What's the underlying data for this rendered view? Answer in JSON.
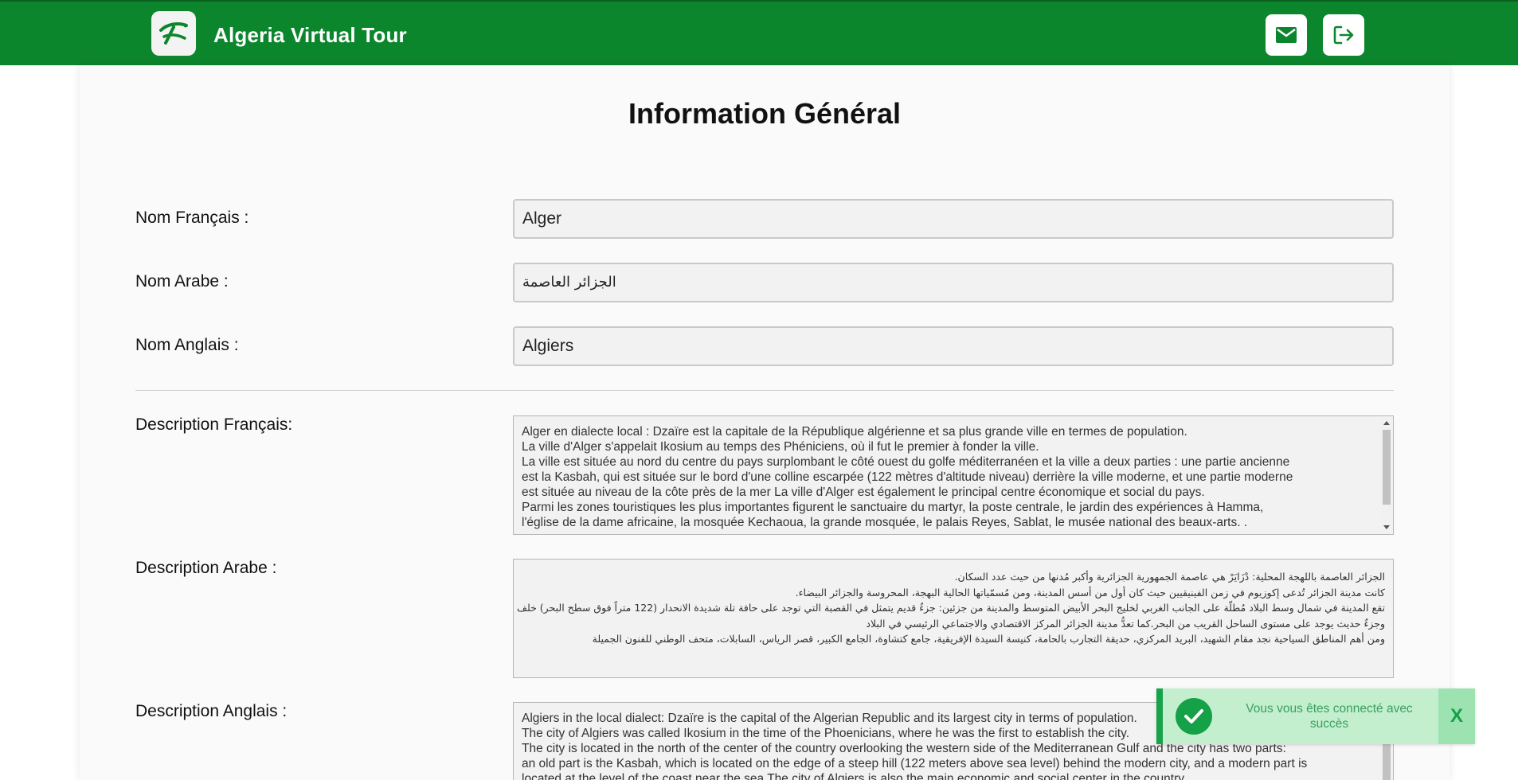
{
  "header": {
    "app_title": "Algeria Virtual Tour",
    "logo_icon": "logo-icon",
    "mail_icon": "mail-icon",
    "logout_icon": "logout-icon",
    "brand_color": "#0c862c"
  },
  "main": {
    "title": "Information Général",
    "fields": {
      "nom_fr": {
        "label": "Nom Français :",
        "value": "Alger"
      },
      "nom_ar": {
        "label": "Nom Arabe :",
        "value": "الجزائر العاصمة"
      },
      "nom_en": {
        "label": "Nom Anglais :",
        "value": "Algiers"
      }
    },
    "descriptions": {
      "fr": {
        "label": "Description Français:",
        "lines": [
          "Alger en dialecte local : Dzaïre est la capitale de la République algérienne et sa plus grande ville en termes de population.",
          "La ville d'Alger s'appelait Ikosium au temps des Phéniciens, où il fut le premier à fonder la ville.",
          "La ville est située au nord du centre du pays surplombant le côté ouest du golfe méditerranéen et la ville a deux parties : une partie ancienne",
          "est la Kasbah, qui est située sur le bord d'une colline escarpée (122 mètres d'altitude niveau) derrière la ville moderne, et une partie moderne",
          "est située au niveau de la côte près de la mer La ville d'Alger est également le principal centre économique et social du pays.",
          "Parmi les zones touristiques les plus importantes figurent le sanctuaire du martyr, la poste centrale, le jardin des expériences à Hamma,",
          "l'église de la dame africaine, la mosquée Kechaoua, la grande mosquée, le palais Reyes, Sablat, le musée national des beaux-arts. ."
        ]
      },
      "ar": {
        "label": "Description Arabe :",
        "lines": [
          "الجزائر العاصمة باللهجة المحلية: دْزَايَرْ هي عاصمة الجمهورية الجزائرية وأكبر مُدنها من حيث عدد السكان.",
          "كانت مدينة الجزائر تُدعى إكوزيوم في زمن الفينيقيين حيث كان أول من أسس المدينة، ومن مُسمّياتها الحالية البهجة، المحروسة والجزائر البيضاء.",
          "تقع المدينة في شمال وسط البلاد مُطلّة على الجانب الغربي لخليج البحر الأبيض المتوسط والمدينة من جزئين: جزءٌ قديم يتمثل في القصبة التي توجد على حافة تلة شديدة الانحدار (122 متراً فوق سطح البحر) خلف المدينة الحديثة،",
          "وجزءٌ حديث يوجد على مستوى الساحل القريب من البحر.كما تعدُّ مدينة الجزائر المركز الاقتصادي والاجتماعي الرئيسي في البلاد",
          "ومن أهم المناطق السياحية نجد مقام الشهيد، البريد المركزي، حديقة التجارب بالحامة، كنيسة السيدة الإفريقية، جامع كتشاوة، الجامع الكبير، قصر الرياس، السابلات، متحف الوطني للفنون الجميلة"
        ]
      },
      "en": {
        "label": "Description Anglais :",
        "lines": [
          "Algiers in the local dialect: Dzaïre is the capital of the Algerian Republic and its largest city in terms of population.",
          "The city of Algiers was called Ikosium in the time of the Phoenicians, where he was the first to establish the city.",
          "The city is located in the north of the center of the country overlooking the western side of the Mediterranean Gulf and the city has two parts:",
          "an old part is the Kasbah, which is located on the edge of a steep hill (122 meters above sea level) behind the modern city, and a modern part is",
          "located at the level of the coast near the sea The city of Algiers is also the main economic and social center in the country."
        ]
      }
    }
  },
  "toast": {
    "message": "Vous vous êtes connecté avec succès",
    "close_label": "X",
    "check_icon": "check-circle-icon",
    "bg_color": "#c3efcf",
    "accent_color": "#15a147"
  }
}
